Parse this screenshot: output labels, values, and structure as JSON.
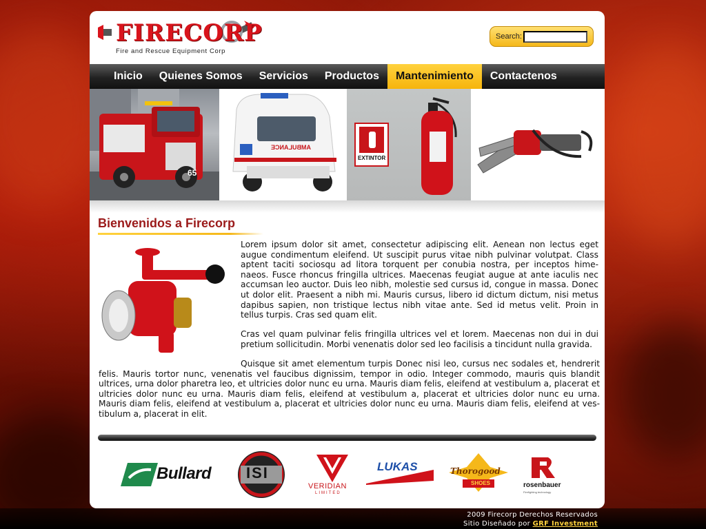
{
  "brand": {
    "logo_text": "FIRECORP",
    "tagline": "Fire and Rescue Equipment Corp"
  },
  "search": {
    "label": "Search:",
    "value": ""
  },
  "nav": {
    "items": [
      {
        "label": "Inicio",
        "active": false
      },
      {
        "label": "Quienes Somos",
        "active": false
      },
      {
        "label": "Servicios",
        "active": false
      },
      {
        "label": "Productos",
        "active": false
      },
      {
        "label": "Mantenimiento",
        "active": true
      },
      {
        "label": "Contactenos",
        "active": false
      }
    ]
  },
  "banner": {
    "ambulance_text": "AMBULANCE",
    "extinguisher_sign": "EXTINTOR",
    "truck_number": "65"
  },
  "content": {
    "title": "Bienvenidos a Firecorp",
    "paragraph1": "Lorem ipsum dolor sit amet, consectetur adipiscing elit. Aenean non lectus eget augue condimentum eleifend. Ut suscipit purus vitae nibh pulvinar volutpat. Class aptent taciti sociosqu ad litora torquent per conubia nostra, per inceptos hime-naeos. Fusce rhoncus fringilla ultrices. Maecenas feugiat augue at ante iaculis nec accumsan leo auctor. Duis leo nibh, molestie sed cursus id, congue in massa. Donec ut dolor elit. Praesent a nibh mi. Mauris cursus, libero id dictum dictum, nisi metus dapibus sapien, non tristique lectus nibh vitae ante. Sed id metus velit. Proin in tellus turpis. Cras sed quam elit.",
    "paragraph2": "Cras vel quam pulvinar felis fringilla ultrices vel et lorem. Maecenas non dui in dui pretium sollicitudin. Morbi venenatis dolor sed leo facilisis a tincidunt nulla gravida.",
    "paragraph3": "Quisque sit amet elementum turpis Donec nisi leo, cursus nec sodales et, hendrerit felis. Mauris tortor nunc, venenatis vel faucibus dignissim, tempor in odio. Integer commodo, mauris quis blandit ultrices, urna dolor pharetra leo, et ultricies dolor nunc eu urna. Mauris diam felis, eleifend at vestibulum a, placerat et ultricies dolor nunc eu urna. Mauris diam felis, eleifend at vestibulum a, placerat  et ultricies dolor nunc eu urna. Mauris diam felis, eleifend at vestibulum a, placerat  et ultricies dolor nunc eu urna. Mauris diam felis, eleifend at ves-tibulum a, placerat in elit."
  },
  "partners": {
    "bullard": "Bullard",
    "isi": "ISI",
    "veridian": "VERIDIAN",
    "veridian_sub": "LIMITED",
    "lukas": "LUKAS",
    "thorogood": "Thorogood",
    "thorogood_sub": "SHOES",
    "rosenbauer": "rosenbauer",
    "rosenbauer_sub": "Firefighting technology"
  },
  "footer": {
    "copyright": "2009 Firecorp Derechos Reservados",
    "designed_by": "Sitio Diseñado por",
    "designer_link": "GRF Investment"
  },
  "colors": {
    "brand_red": "#d9141c",
    "title_red": "#9b1a1a",
    "accent_yellow": "#f6b40c",
    "nav_dark": "#222222"
  }
}
